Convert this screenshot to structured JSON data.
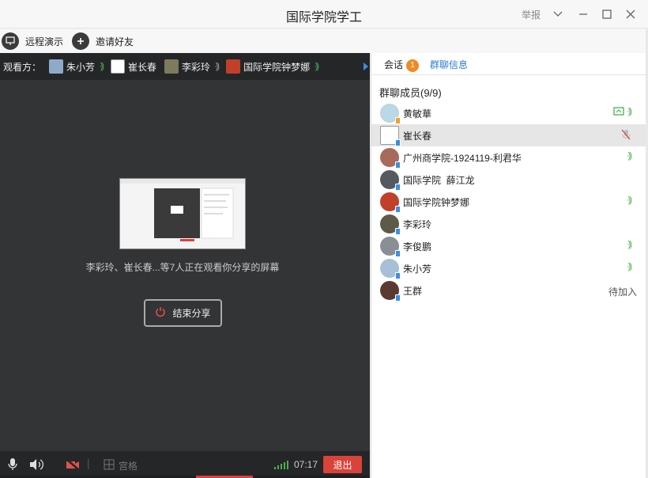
{
  "window": {
    "title": "国际学院学工",
    "report": "举报"
  },
  "toolbar": {
    "remote_demo": "远程演示",
    "invite": "邀请好友"
  },
  "viewers": {
    "label": "观看方：",
    "list": [
      {
        "name": "朱小芳",
        "color": "#8fa9c9"
      },
      {
        "name": "崔长春",
        "color": "#ffffff"
      },
      {
        "name": "李彩玲",
        "color": "#7d7a5e"
      },
      {
        "name": "国际学院钟梦娜",
        "color": "#c0402a"
      }
    ]
  },
  "share": {
    "watching_text": "李彩玲、崔长春...等7人正在观看你分享的屏幕",
    "end_label": "结束分享"
  },
  "bottombar": {
    "grid_label": "宫格",
    "timer": "07:17",
    "exit": "退出"
  },
  "panel": {
    "tab_session": "会话",
    "tab_badge": "1",
    "tab_group_info": "群聊信息",
    "members_title": "群聊成员(9/9)",
    "members": [
      {
        "name": "黄敏華",
        "color": "#b9d8e8",
        "status": "screen+voice"
      },
      {
        "name": "崔长春",
        "color": "#ffffff",
        "status": "muted",
        "selected": true
      },
      {
        "name": "广州商学院-1924119-利君华",
        "color": "#a86a5a",
        "status": "voice"
      },
      {
        "name": "国际学院  薛江龙",
        "color": "#555a60",
        "status": "none"
      },
      {
        "name": "国际学院钟梦娜",
        "color": "#c0402a",
        "status": "voice"
      },
      {
        "name": "李彩玲",
        "color": "#5e5a48",
        "status": "none"
      },
      {
        "name": "李俊鹏",
        "color": "#8a8f96",
        "status": "voice"
      },
      {
        "name": "朱小芳",
        "color": "#a8bfd8",
        "status": "voice"
      },
      {
        "name": "王群",
        "color": "#5a3a30",
        "status": "pending",
        "pending_text": "待加入"
      }
    ]
  },
  "colors": {
    "accent": "#2d7bd6",
    "exit": "#d8433a",
    "signal": "#4caf50",
    "badge": "#f08a24"
  }
}
